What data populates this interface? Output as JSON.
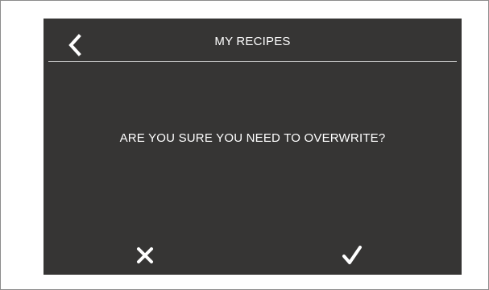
{
  "header": {
    "title": "MY RECIPES",
    "back_icon": "chevron-left-icon"
  },
  "dialog": {
    "message": "ARE YOU SURE YOU NEED TO OVERWRITE?"
  },
  "actions": {
    "cancel_icon": "close-icon",
    "confirm_icon": "check-icon"
  },
  "colors": {
    "screen_background": "#363534",
    "text": "#ffffff",
    "divider": "#cfcfcf",
    "frame_border": "#8c8c8c"
  }
}
